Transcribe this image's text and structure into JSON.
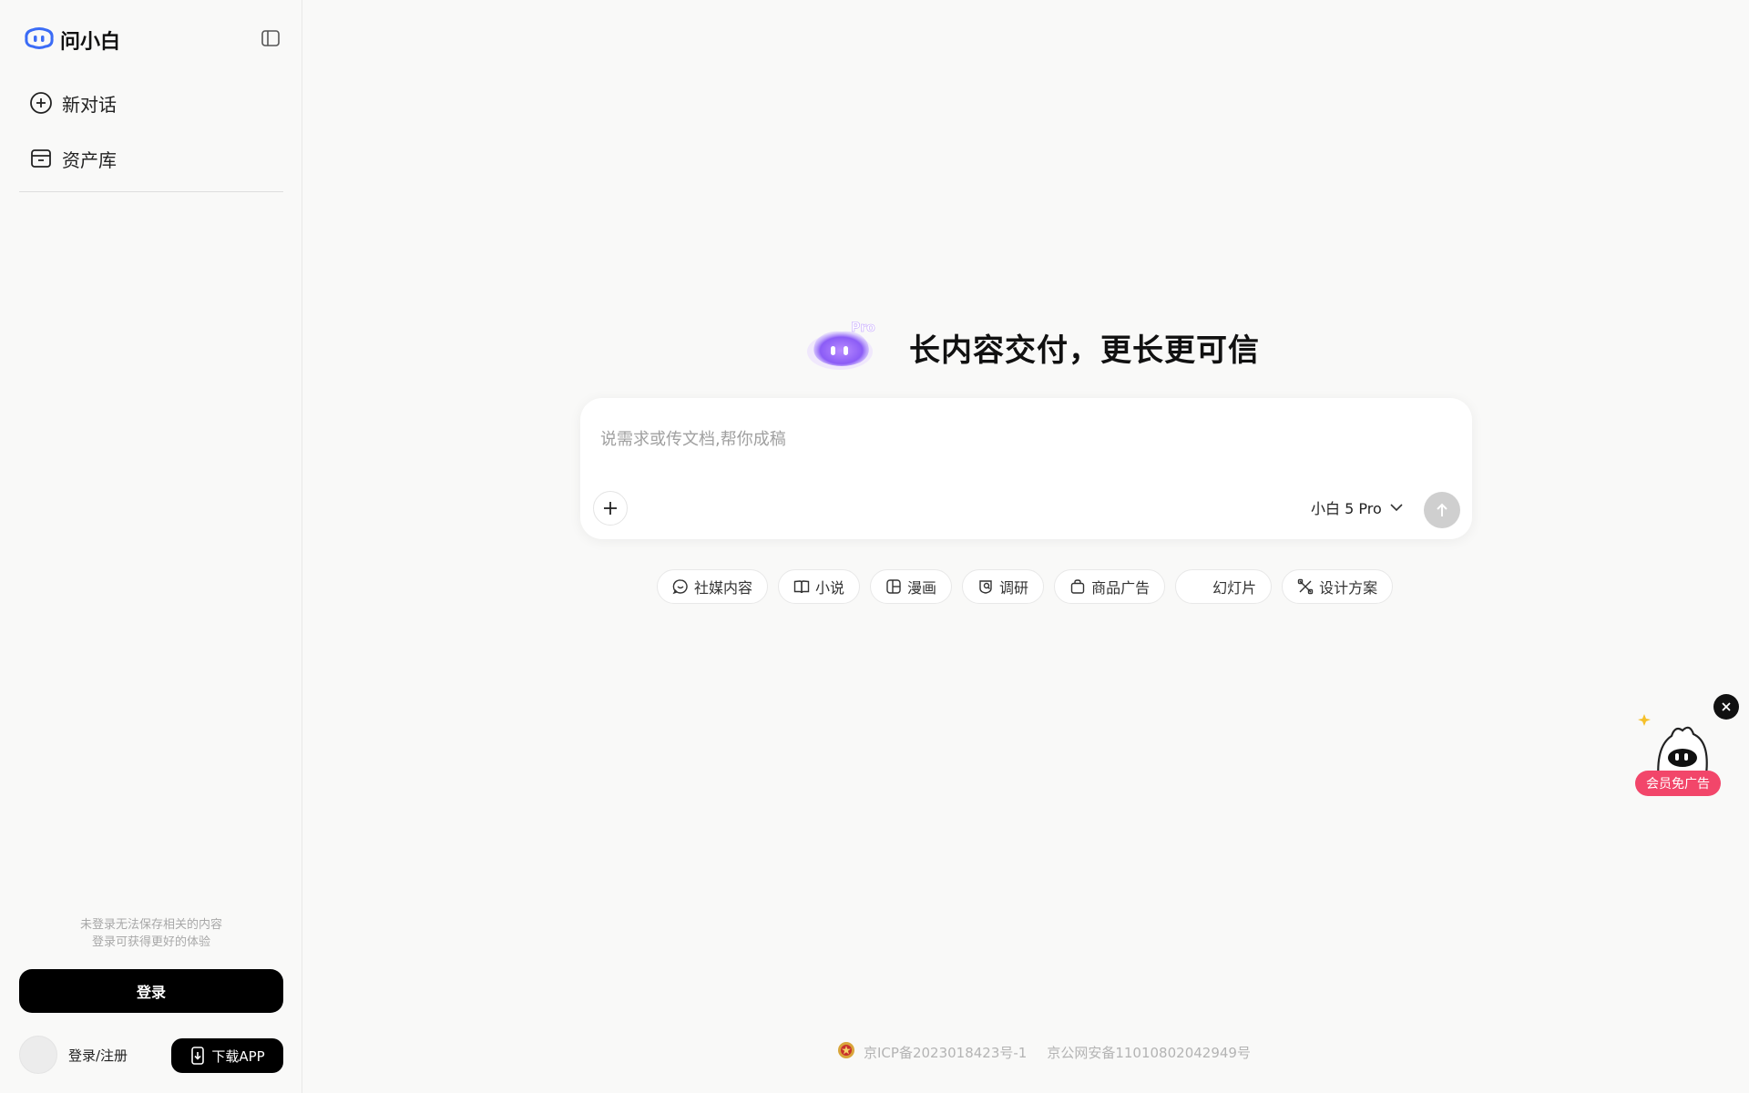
{
  "brand": {
    "name": "问小白",
    "logo_icon": "cloud-logo-icon"
  },
  "sidebar": {
    "collapse_icon": "sidebar-toggle-icon",
    "items": [
      {
        "label": "新对话",
        "icon": "plus-circle-icon"
      },
      {
        "label": "资产库",
        "icon": "archive-box-icon"
      }
    ],
    "notice_line1": "未登录无法保存相关的内容",
    "notice_line2": "登录可获得更好的体验",
    "login_label": "登录",
    "user_label": "登录/注册",
    "download_label": "下载APP"
  },
  "hero": {
    "badge": "Pro",
    "title": "长内容交付，更长更可信"
  },
  "composer": {
    "placeholder": "说需求或传文档,帮你成稿",
    "value": "",
    "model_label": "小白 5 Pro"
  },
  "chips": [
    {
      "label": "社媒内容",
      "icon": "chat-bubble-icon"
    },
    {
      "label": "小说",
      "icon": "book-icon"
    },
    {
      "label": "漫画",
      "icon": "comic-panel-icon"
    },
    {
      "label": "调研",
      "icon": "research-icon"
    },
    {
      "label": "商品广告",
      "icon": "shopping-bag-icon"
    },
    {
      "label": "幻灯片",
      "icon": ""
    },
    {
      "label": "设计方案",
      "icon": "design-tools-icon"
    }
  ],
  "footer": {
    "icp": "京ICP备2023018423号-1",
    "police": "京公网安备11010802042949号"
  },
  "promo": {
    "badge": "会员免广告"
  },
  "colors": {
    "accent_purple": "#8b5cf6",
    "brand_blue": "#3b6cf6",
    "promo_pink": "#f2466a",
    "primary_black": "#000000"
  }
}
